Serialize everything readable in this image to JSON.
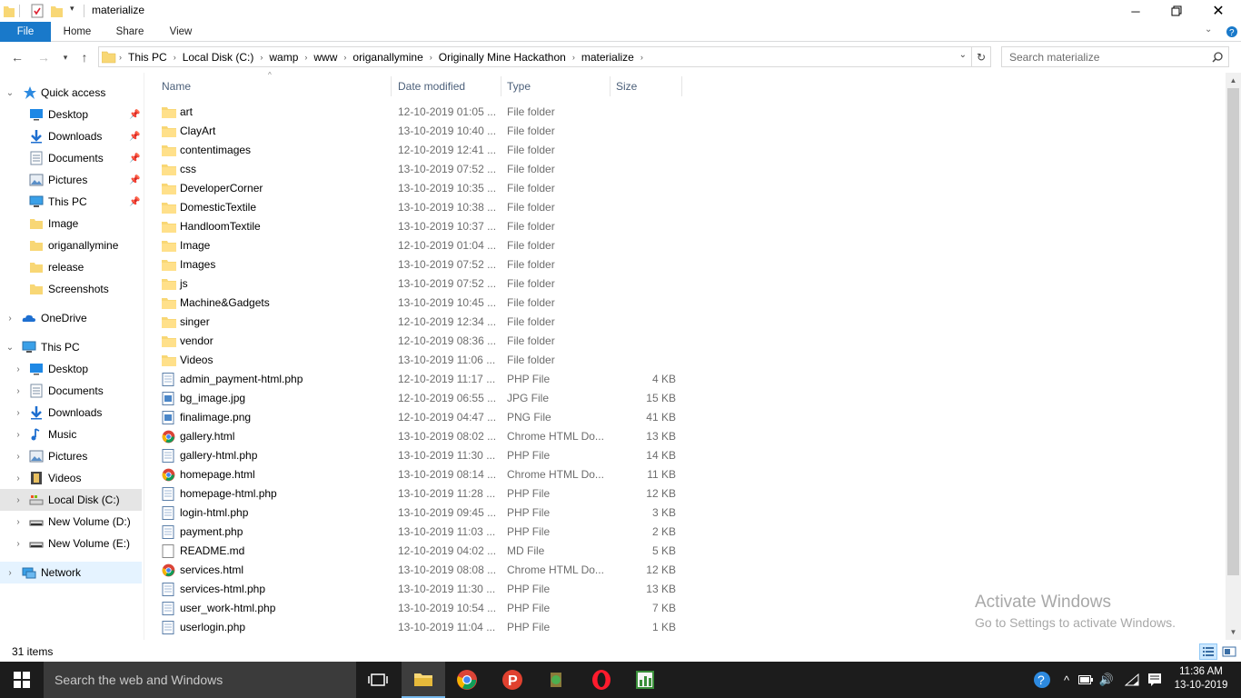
{
  "window": {
    "title": "materialize",
    "minimize_icon": "minimize-icon",
    "maximize_icon": "restore-icon",
    "close_icon": "close-icon"
  },
  "ribbon": {
    "tabs": [
      "File",
      "Home",
      "Share",
      "View"
    ],
    "accent": "#1979ca"
  },
  "address": {
    "crumbs": [
      "This PC",
      "Local Disk (C:)",
      "wamp",
      "www",
      "origanallymine",
      "Originally Mine Hackathon",
      "materialize"
    ]
  },
  "search": {
    "placeholder": "Search materialize"
  },
  "nav": {
    "quick_access": "Quick access",
    "quick_items": [
      {
        "label": "Desktop",
        "icon": "desktop-icon",
        "pinned": true
      },
      {
        "label": "Downloads",
        "icon": "downloads-icon",
        "pinned": true
      },
      {
        "label": "Documents",
        "icon": "documents-icon",
        "pinned": true
      },
      {
        "label": "Pictures",
        "icon": "pictures-icon",
        "pinned": true
      },
      {
        "label": "This PC",
        "icon": "this-pc-icon",
        "pinned": true
      },
      {
        "label": "Image",
        "icon": "folder-icon",
        "pinned": false
      },
      {
        "label": "origanallymine",
        "icon": "folder-icon",
        "pinned": false
      },
      {
        "label": "release",
        "icon": "folder-icon",
        "pinned": false
      },
      {
        "label": "Screenshots",
        "icon": "folder-icon",
        "pinned": false
      }
    ],
    "onedrive": "OneDrive",
    "this_pc": "This PC",
    "pc_items": [
      {
        "label": "Desktop",
        "icon": "desktop-icon"
      },
      {
        "label": "Documents",
        "icon": "documents-icon"
      },
      {
        "label": "Downloads",
        "icon": "downloads-icon"
      },
      {
        "label": "Music",
        "icon": "music-icon"
      },
      {
        "label": "Pictures",
        "icon": "pictures-icon"
      },
      {
        "label": "Videos",
        "icon": "videos-icon"
      },
      {
        "label": "Local Disk (C:)",
        "icon": "local-disk-icon"
      },
      {
        "label": "New Volume (D:)",
        "icon": "drive-icon"
      },
      {
        "label": "New Volume (E:)",
        "icon": "drive-icon"
      }
    ],
    "network": "Network"
  },
  "columns": {
    "name": "Name",
    "date": "Date modified",
    "type": "Type",
    "size": "Size"
  },
  "files": [
    {
      "name": "art",
      "date": "12-10-2019 01:05 ...",
      "type": "File folder",
      "size": "",
      "icon": "folder"
    },
    {
      "name": "ClayArt",
      "date": "13-10-2019 10:40 ...",
      "type": "File folder",
      "size": "",
      "icon": "folder"
    },
    {
      "name": "contentimages",
      "date": "12-10-2019 12:41 ...",
      "type": "File folder",
      "size": "",
      "icon": "folder"
    },
    {
      "name": "css",
      "date": "13-10-2019 07:52 ...",
      "type": "File folder",
      "size": "",
      "icon": "folder"
    },
    {
      "name": "DeveloperCorner",
      "date": "13-10-2019 10:35 ...",
      "type": "File folder",
      "size": "",
      "icon": "folder"
    },
    {
      "name": "DomesticTextile",
      "date": "13-10-2019 10:38 ...",
      "type": "File folder",
      "size": "",
      "icon": "folder"
    },
    {
      "name": "HandloomTextile",
      "date": "13-10-2019 10:37 ...",
      "type": "File folder",
      "size": "",
      "icon": "folder"
    },
    {
      "name": "Image",
      "date": "12-10-2019 01:04 ...",
      "type": "File folder",
      "size": "",
      "icon": "folder"
    },
    {
      "name": "Images",
      "date": "13-10-2019 07:52 ...",
      "type": "File folder",
      "size": "",
      "icon": "folder"
    },
    {
      "name": "js",
      "date": "13-10-2019 07:52 ...",
      "type": "File folder",
      "size": "",
      "icon": "folder"
    },
    {
      "name": "Machine&Gadgets",
      "date": "13-10-2019 10:45 ...",
      "type": "File folder",
      "size": "",
      "icon": "folder"
    },
    {
      "name": "singer",
      "date": "12-10-2019 12:34 ...",
      "type": "File folder",
      "size": "",
      "icon": "folder"
    },
    {
      "name": "vendor",
      "date": "12-10-2019 08:36 ...",
      "type": "File folder",
      "size": "",
      "icon": "folder"
    },
    {
      "name": "Videos",
      "date": "13-10-2019 11:06 ...",
      "type": "File folder",
      "size": "",
      "icon": "folder"
    },
    {
      "name": "admin_payment-html.php",
      "date": "12-10-2019 11:17 ...",
      "type": "PHP File",
      "size": "4 KB",
      "icon": "php"
    },
    {
      "name": "bg_image.jpg",
      "date": "12-10-2019 06:55 ...",
      "type": "JPG File",
      "size": "15 KB",
      "icon": "image"
    },
    {
      "name": "finalimage.png",
      "date": "12-10-2019 04:47 ...",
      "type": "PNG File",
      "size": "41 KB",
      "icon": "image"
    },
    {
      "name": "gallery.html",
      "date": "13-10-2019 08:02 ...",
      "type": "Chrome HTML Do...",
      "size": "13 KB",
      "icon": "chrome"
    },
    {
      "name": "gallery-html.php",
      "date": "13-10-2019 11:30 ...",
      "type": "PHP File",
      "size": "14 KB",
      "icon": "php"
    },
    {
      "name": "homepage.html",
      "date": "13-10-2019 08:14 ...",
      "type": "Chrome HTML Do...",
      "size": "11 KB",
      "icon": "chrome"
    },
    {
      "name": "homepage-html.php",
      "date": "13-10-2019 11:28 ...",
      "type": "PHP File",
      "size": "12 KB",
      "icon": "php"
    },
    {
      "name": "login-html.php",
      "date": "13-10-2019 09:45 ...",
      "type": "PHP File",
      "size": "3 KB",
      "icon": "php"
    },
    {
      "name": "payment.php",
      "date": "13-10-2019 11:03 ...",
      "type": "PHP File",
      "size": "2 KB",
      "icon": "php"
    },
    {
      "name": "README.md",
      "date": "12-10-2019 04:02 ...",
      "type": "MD File",
      "size": "5 KB",
      "icon": "blank"
    },
    {
      "name": "services.html",
      "date": "13-10-2019 08:08 ...",
      "type": "Chrome HTML Do...",
      "size": "12 KB",
      "icon": "chrome"
    },
    {
      "name": "services-html.php",
      "date": "13-10-2019 11:30 ...",
      "type": "PHP File",
      "size": "13 KB",
      "icon": "php"
    },
    {
      "name": "user_work-html.php",
      "date": "13-10-2019 10:54 ...",
      "type": "PHP File",
      "size": "7 KB",
      "icon": "php"
    },
    {
      "name": "userlogin.php",
      "date": "13-10-2019 11:04 ...",
      "type": "PHP File",
      "size": "1 KB",
      "icon": "php"
    }
  ],
  "status": {
    "item_count": "31 items"
  },
  "watermark": {
    "line1": "Activate Windows",
    "line2": "Go to Settings to activate Windows."
  },
  "taskbar": {
    "search_placeholder": "Search the web and Windows",
    "time": "11:36 AM",
    "date": "13-10-2019"
  }
}
